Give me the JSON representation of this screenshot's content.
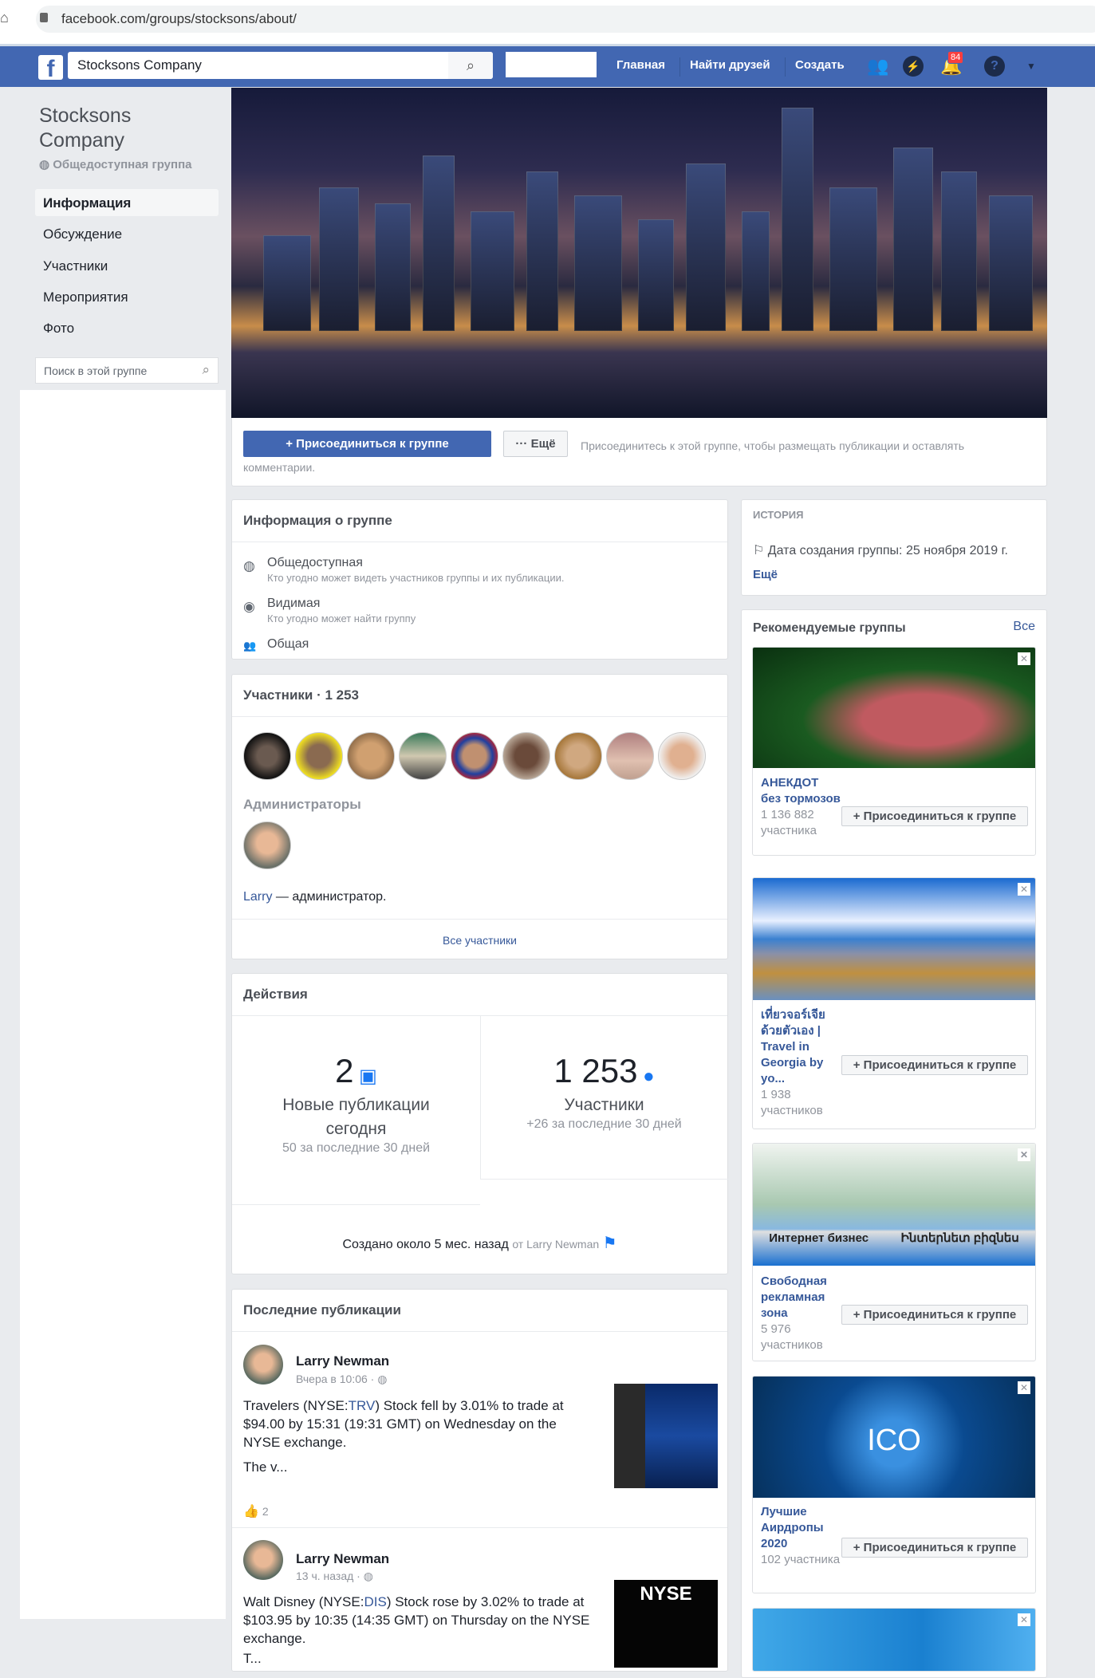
{
  "browser": {
    "url": "facebook.com/groups/stocksons/about/"
  },
  "topnav": {
    "search_value": "Stocksons Company",
    "links": [
      "Главная",
      "Найти друзей",
      "Создать"
    ],
    "notification_count": "84"
  },
  "group": {
    "name": "Stocksons Company",
    "privacy": "Общедоступная группа"
  },
  "sidebar": {
    "items": [
      {
        "label": "Информация"
      },
      {
        "label": "Обсуждение"
      },
      {
        "label": "Участники"
      },
      {
        "label": "Мероприятия"
      },
      {
        "label": "Фото"
      }
    ],
    "search_placeholder": "Поиск в этой группе"
  },
  "join": {
    "button": "+ Присоединиться к группе",
    "more": "··· Ещё",
    "hint": "Присоединитесь к этой группе, чтобы размещать публикации и оставлять комментарии."
  },
  "info": {
    "title": "Информация о группе",
    "items": [
      {
        "title": "Общедоступная",
        "sub": "Кто угодно может видеть участников группы и их публикации."
      },
      {
        "title": "Видимая",
        "sub": "Кто угодно может найти группу"
      },
      {
        "title": "Общая"
      }
    ]
  },
  "history": {
    "title": "ИСТОРИЯ",
    "created": "Дата создания группы: 25 ноября 2019 г.",
    "more": "Ещё"
  },
  "members": {
    "title": "Участники · 1 253",
    "admins_label": "Администраторы",
    "admin_name": "Larry",
    "admin_suffix": " — администратор.",
    "all_link": "Все участники"
  },
  "activity": {
    "title": "Действия",
    "posts_count": "2",
    "posts_label": "Новые публикации сегодня",
    "posts_sub": "50 за последние 30 дней",
    "members_count": "1 253",
    "members_label": "Участники",
    "members_sub": "+26 за последние 30 дней",
    "created": "Создано около 5 мес. назад",
    "created_by": "от Larry Newman"
  },
  "recent": {
    "title": "Последние публикации",
    "posts": [
      {
        "author": "Larry Newman",
        "time": "Вчера в 10:06 ·",
        "text_pre": "Travelers (NYSE:",
        "ticker": "TRV",
        "text_post": ") Stock fell by 3.01% to trade at $94.00 by 15:31 (19:31 GMT) on Wednesday on the NYSE exchange.",
        "more": "The v...",
        "likes": "2"
      },
      {
        "author": "Larry Newman",
        "time": "13 ч. назад ·",
        "text_pre": "Walt  Disney  (NYSE:",
        "ticker": "DIS",
        "text_post": ") Stock rose by 3.02% to trade at $103.95 by 10:35 (14:35 GMT) on Thursday on the NYSE exchange.",
        "more": "T...",
        "image_text": "NYSE"
      }
    ]
  },
  "suggested": {
    "title": "Рекомендуемые группы",
    "all": "Все",
    "join_label": "+ Присоединиться к группе",
    "groups": [
      {
        "name": "АНЕКДОТ без тормозов",
        "count": "1 136 882 участника"
      },
      {
        "name": "เที่ยวจอร์เจียด้วยตัวเอง | Travel in Georgia by yo...",
        "count": "1 938 участников"
      },
      {
        "name": "Свободная рекламная зона",
        "count": "5 976 участников",
        "image_text_left": "Интернет бизнес",
        "image_text_right": "Ինտերնետ բիզնես"
      },
      {
        "name": "Лучшие Аирдропы 2020",
        "count": "102 участника",
        "image_text": "ICO"
      }
    ]
  },
  "colors": {
    "brand": "#4267b2",
    "link": "#365899",
    "accent": "#1877f2",
    "page_bg": "#e9ebee"
  }
}
